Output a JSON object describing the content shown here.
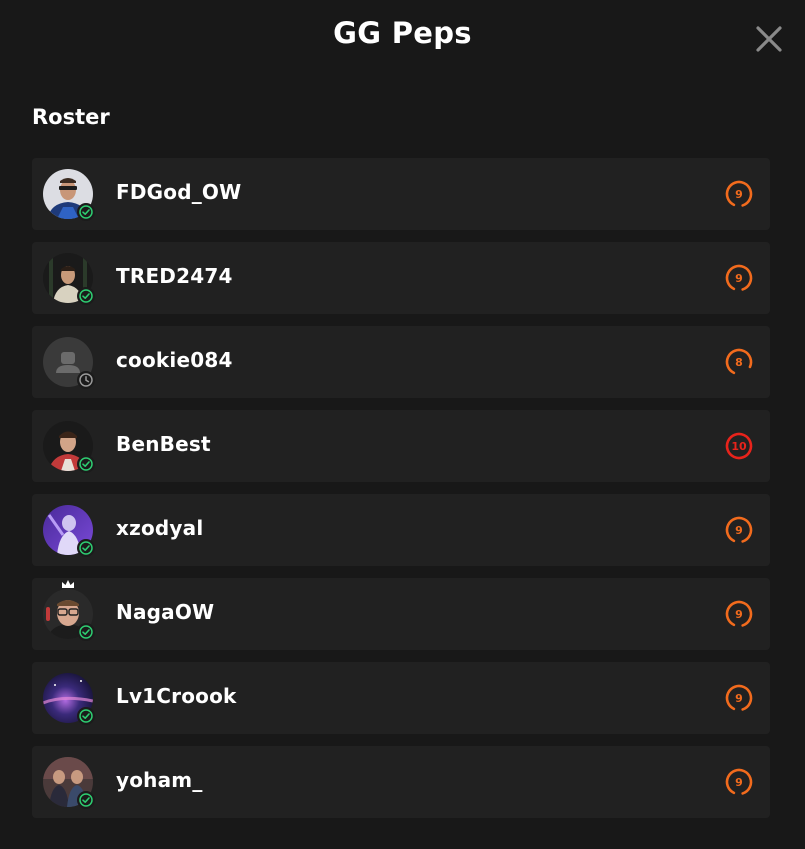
{
  "header": {
    "title": "GG Peps"
  },
  "section": {
    "title": "Roster"
  },
  "colors": {
    "background": "#181818",
    "row": "#212121",
    "rating_orange": "#f26b1d",
    "rating_red": "#e8231b",
    "online_green": "#2ecc71",
    "offline_gray": "#9a9a9a"
  },
  "players": [
    {
      "name": "FDGod_OW",
      "rating": "9",
      "status": "online",
      "captain": false,
      "avatar": "photo"
    },
    {
      "name": "TRED2474",
      "rating": "9",
      "status": "online",
      "captain": false,
      "avatar": "photo"
    },
    {
      "name": "cookie084",
      "rating": "8",
      "status": "away",
      "captain": false,
      "avatar": "default-user"
    },
    {
      "name": "BenBest",
      "rating": "10",
      "status": "online",
      "captain": false,
      "avatar": "photo"
    },
    {
      "name": "xzodyal",
      "rating": "9",
      "status": "online",
      "captain": false,
      "avatar": "photo"
    },
    {
      "name": "NagaOW",
      "rating": "9",
      "status": "online",
      "captain": true,
      "avatar": "photo"
    },
    {
      "name": "Lv1Croook",
      "rating": "9",
      "status": "online",
      "captain": false,
      "avatar": "photo"
    },
    {
      "name": "yoham_",
      "rating": "9",
      "status": "online",
      "captain": false,
      "avatar": "photo"
    }
  ]
}
